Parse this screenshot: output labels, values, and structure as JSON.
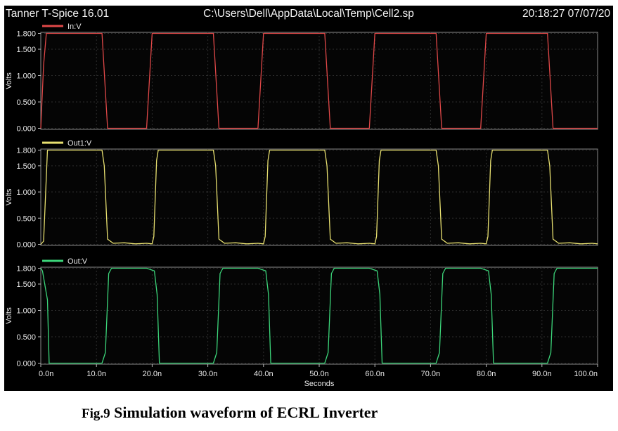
{
  "window": {
    "app_title": "Tanner T-Spice 16.01",
    "file_path": "C:\\Users\\Dell\\AppData\\Local\\Temp\\Cell2.sp",
    "timestamp": "20:18:27 07/07/20"
  },
  "caption": {
    "fig_label": "Fig.9",
    "text": "Simulation waveform of ECRL Inverter"
  },
  "chart_data": [
    {
      "type": "line",
      "legend": "In:V",
      "color": "#e04848",
      "ylabel": "Volts",
      "ylim": [
        -0.02,
        1.82
      ],
      "yticks": [
        "1.800",
        "1.500",
        "1.000",
        "0.500",
        "0.000"
      ],
      "ytick_values": [
        1.8,
        1.5,
        1.0,
        0.5,
        0.0
      ],
      "xlim": [
        0,
        100
      ],
      "grid": true,
      "series": [
        {
          "name": "In:V",
          "x": [
            0,
            0.5,
            1,
            11,
            12,
            19,
            20,
            31,
            32,
            39,
            40,
            51,
            52,
            59,
            60,
            71,
            72,
            79,
            80,
            91,
            92,
            100
          ],
          "y": [
            0,
            1.2,
            1.8,
            1.8,
            0,
            0,
            1.8,
            1.8,
            0,
            0,
            1.8,
            1.8,
            0,
            0,
            1.8,
            1.8,
            0,
            0,
            1.8,
            1.8,
            0,
            0
          ]
        }
      ]
    },
    {
      "type": "line",
      "legend": "Out1:V",
      "color": "#e8e070",
      "ylabel": "Volts",
      "ylim": [
        -0.02,
        1.82
      ],
      "yticks": [
        "1.800",
        "1.500",
        "1.000",
        "0.500",
        "0.000"
      ],
      "ytick_values": [
        1.8,
        1.5,
        1.0,
        0.5,
        0.0
      ],
      "xlim": [
        0,
        100
      ],
      "grid": true,
      "series": [
        {
          "name": "Out1:V",
          "x": [
            0,
            0.5,
            1.2,
            11,
            11.4,
            12,
            13,
            15,
            17,
            19,
            20,
            20.3,
            20.8,
            21.1,
            31,
            31.4,
            32,
            33,
            35,
            37,
            39,
            40,
            40.3,
            40.8,
            41.1,
            51,
            51.4,
            52,
            53,
            55,
            57,
            59,
            60,
            60.3,
            60.8,
            61.1,
            71,
            71.4,
            72,
            73,
            75,
            77,
            79,
            80,
            80.3,
            80.8,
            81.1,
            91,
            91.4,
            92,
            93,
            95,
            97,
            99,
            100
          ],
          "y": [
            0,
            0.06,
            1.8,
            1.8,
            1.5,
            0.1,
            0.02,
            0.03,
            0.01,
            0.02,
            0.01,
            0.15,
            1.6,
            1.8,
            1.8,
            1.5,
            0.1,
            0.02,
            0.03,
            0.01,
            0.02,
            0.01,
            0.15,
            1.6,
            1.8,
            1.8,
            1.5,
            0.1,
            0.02,
            0.03,
            0.01,
            0.02,
            0.01,
            0.15,
            1.6,
            1.8,
            1.8,
            1.5,
            0.1,
            0.02,
            0.03,
            0.01,
            0.02,
            0.01,
            0.15,
            1.6,
            1.8,
            1.8,
            1.5,
            0.1,
            0.02,
            0.03,
            0.01,
            0.02,
            0.01
          ]
        }
      ]
    },
    {
      "type": "line",
      "legend": "Out:V",
      "color": "#3cd67a",
      "ylabel": "Volts",
      "ylim": [
        -0.02,
        1.82
      ],
      "yticks": [
        "1.800",
        "1.500",
        "1.000",
        "0.500",
        "0.000"
      ],
      "ytick_values": [
        1.8,
        1.5,
        1.0,
        0.5,
        0.0
      ],
      "xlim": [
        0,
        100
      ],
      "grid": true,
      "series": [
        {
          "name": "Out:V",
          "x": [
            0,
            0.3,
            1.2,
            1.5,
            11,
            11.6,
            12.2,
            12.7,
            19,
            20.4,
            20.9,
            21.3,
            31,
            31.6,
            32.2,
            32.7,
            39,
            40.4,
            40.9,
            41.3,
            51,
            51.6,
            52.2,
            52.7,
            59,
            60.4,
            60.9,
            61.3,
            71,
            71.6,
            72.2,
            72.7,
            79,
            80.4,
            80.9,
            81.3,
            91,
            91.6,
            92.2,
            92.7,
            100
          ],
          "y": [
            1.8,
            1.75,
            1.2,
            0,
            0,
            0.2,
            1.7,
            1.8,
            1.8,
            1.75,
            1.3,
            0,
            0,
            0.2,
            1.7,
            1.8,
            1.8,
            1.75,
            1.3,
            0,
            0,
            0.2,
            1.7,
            1.8,
            1.8,
            1.75,
            1.3,
            0,
            0,
            0.2,
            1.7,
            1.8,
            1.8,
            1.75,
            1.3,
            0,
            0,
            0.2,
            1.7,
            1.8,
            1.8
          ]
        }
      ]
    }
  ],
  "x_axis": {
    "label": "Seconds",
    "ticks": [
      "0.0n",
      "10.0n",
      "20.0n",
      "30.0n",
      "40.0n",
      "50.0n",
      "60.0n",
      "70.0n",
      "80.0n",
      "90.0n",
      "100.0n"
    ],
    "tick_values": [
      0,
      10,
      20,
      30,
      40,
      50,
      60,
      70,
      80,
      90,
      100
    ],
    "unit_note": "ns"
  }
}
